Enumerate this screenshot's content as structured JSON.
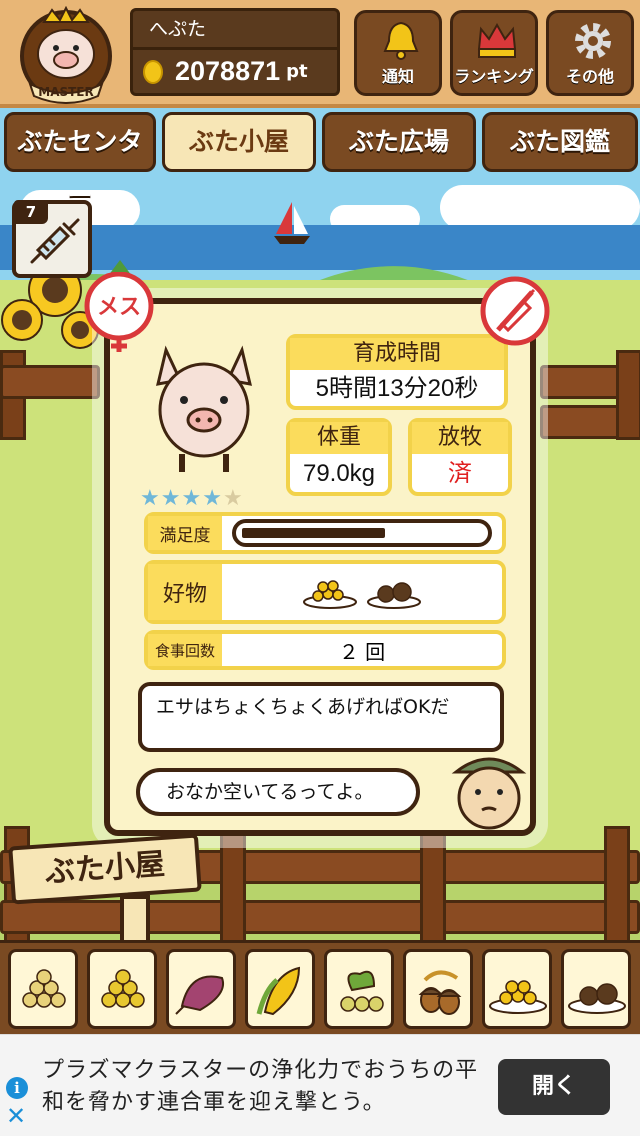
{
  "header": {
    "badge_text": "MASTER",
    "user_name": "へぷた",
    "points_value": "2078871",
    "points_unit": "pt",
    "buttons": [
      {
        "label": "通知",
        "icon": "bell-icon"
      },
      {
        "label": "ランキング",
        "icon": "crown-icon"
      },
      {
        "label": "その他",
        "icon": "gear-icon"
      }
    ]
  },
  "tabs": [
    {
      "label": "ぶたセンター",
      "active": false
    },
    {
      "label": "ぶた小屋",
      "active": true
    },
    {
      "label": "ぶた広場",
      "active": false
    },
    {
      "label": "ぶた図鑑",
      "active": false
    }
  ],
  "syringe": {
    "count": "7"
  },
  "pig": {
    "gender_label": "メス",
    "rating": 4,
    "rating_max": 5
  },
  "info": {
    "growth_label": "育成時間",
    "growth_value": "5時間13分20秒",
    "weight_label": "体重",
    "weight_value": "79.0kg",
    "graze_label": "放牧",
    "graze_value": "済",
    "satisfaction_label": "満足度",
    "satisfaction_level": 0.62,
    "favorite_label": "好物",
    "meals_label": "食事回数",
    "meals_value": "２ 回"
  },
  "dialog": {
    "tip": "エサはちょくちょくあげればOKだ",
    "speech": "おなか空いてるってよ。"
  },
  "sign": {
    "label": "ぶた小屋"
  },
  "feeds": [
    "soybean-icon",
    "corn-grain-icon",
    "sweet-potato-icon",
    "corn-icon",
    "herb-beans-icon",
    "acorn-icon",
    "corn-plate-icon",
    "meatball-plate-icon"
  ],
  "ad": {
    "text": "プラズマクラスターの浄化力でおうちの平和を脅かす連合軍を迎え撃とう。",
    "button": "開く"
  },
  "colors": {
    "wood": "#7a4a22",
    "wood_dark": "#3f2410",
    "card_bg": "#fbf3c8",
    "accent_yellow": "#fbdc5c",
    "female_red": "#d9383a",
    "graze_red": "#e02020"
  }
}
